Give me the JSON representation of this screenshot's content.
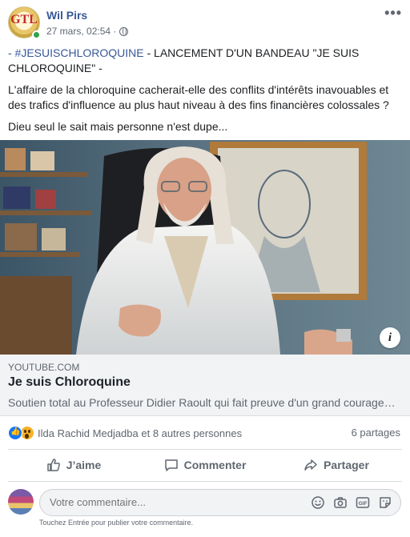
{
  "post": {
    "author": "Wil Pirs",
    "timestamp": "27 mars, 02:54 ·",
    "avatar_text": "GTL",
    "more_label": "•••",
    "hashtag": "- #JESUISCHLOROQUINE",
    "headline_rest": " - LANCEMENT D'UN BANDEAU \"JE SUIS CHLOROQUINE\" -",
    "paragraph_1": "L'affaire de la chloroquine cacherait-elle des conflits d'intérêts inavouables et des trafics d'influence au plus haut niveau à des fins financières colossales ?",
    "paragraph_2": "Dieu seul le sait mais personne n'est dupe..."
  },
  "media": {
    "info_label": "i"
  },
  "link_card": {
    "domain": "YOUTUBE.COM",
    "title": "Je suis Chloroquine",
    "description": "Soutien total au Professeur Didier Raoult qui fait preuve d'un grand courage…"
  },
  "reactions": {
    "names": "Ilda Rachid Medjadba et 8 autres personnes",
    "shares": "6 partages",
    "types": [
      "like-icon",
      "wow-icon"
    ]
  },
  "actions": {
    "like": "J’aime",
    "comment": "Commenter",
    "share": "Partager"
  },
  "composer": {
    "placeholder": "Votre commentaire...",
    "hint": "Touchez Entrée pour publier votre commentaire.",
    "icons": [
      "emoji-icon",
      "camera-icon",
      "gif-icon",
      "sticker-icon"
    ],
    "gif_label": "GIF"
  },
  "colors": {
    "link": "#385898",
    "meta": "#606770",
    "like_blue": "#1877f2",
    "online": "#31a24c"
  }
}
